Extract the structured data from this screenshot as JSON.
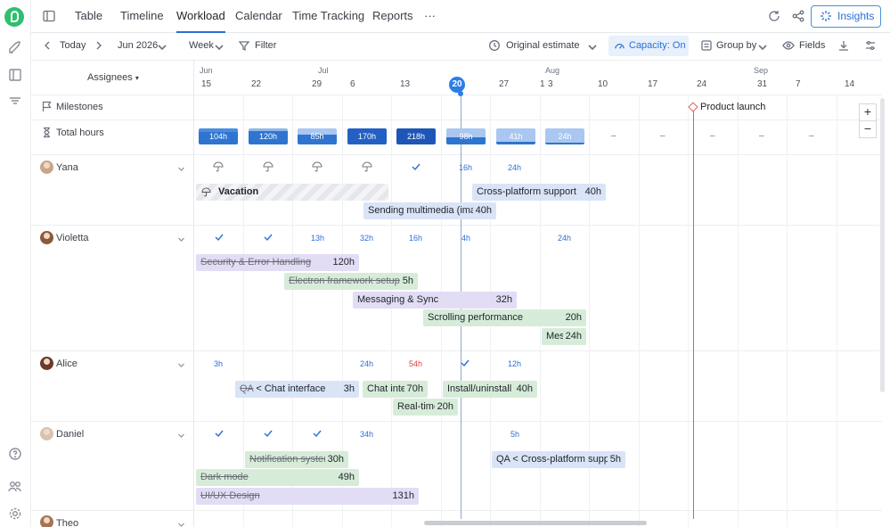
{
  "tabs": [
    "Table",
    "Timeline",
    "Workload",
    "Calendar",
    "Time Tracking",
    "Reports",
    "···"
  ],
  "insights_label": "Insights",
  "toolbar": {
    "today": "Today",
    "date": "Jun 2026",
    "view": "Week",
    "filter": "Filter",
    "estimate": "Original estimate",
    "capacity": "Capacity: On",
    "group_by": "Group by",
    "fields": "Fields"
  },
  "assignees_label": "Assignees",
  "months": [
    "Jun",
    "Jul",
    "Aug",
    "Sep"
  ],
  "days": [
    "15",
    "22",
    "29",
    "6",
    "13",
    "20",
    "27",
    "1",
    "3",
    "10",
    "17",
    "24",
    "31",
    "7",
    "14"
  ],
  "today_day": "20",
  "rows": {
    "milestones": "Milestones",
    "total_hours": "Total hours",
    "people": [
      "Yana",
      "Violetta",
      "Alice",
      "Daniel",
      "Theo"
    ]
  },
  "milestone_label": "Product launch",
  "total_hours": [
    "104h",
    "120h",
    "85h",
    "170h",
    "218h",
    "98h",
    "41h",
    "24h",
    "–",
    "–",
    "–",
    "–",
    "–"
  ],
  "workload": {
    "yana": [
      "16h",
      "24h"
    ],
    "violetta": [
      "13h",
      "32h",
      "16h",
      "4h",
      "24h"
    ],
    "alice": [
      "3h",
      "24h",
      "54h",
      "12h"
    ],
    "daniel": [
      "34h",
      "5h"
    ]
  },
  "tasks": {
    "vacation": {
      "name": "Vacation"
    },
    "cross_platform": {
      "name": "Cross-platform support",
      "hours": "40h"
    },
    "multimedia": {
      "name": "Sending multimedia (imag",
      "hours": "40h"
    },
    "security": {
      "name": "Security & Error Handling",
      "hours": "120h"
    },
    "electron": {
      "name": "Electron framework setup",
      "hours": "5h"
    },
    "messaging": {
      "name": "Messaging & Sync",
      "hours": "32h"
    },
    "scrolling": {
      "name": "Scrolling performance",
      "hours": "20h"
    },
    "mes": {
      "name": "Mes",
      "hours": "24h"
    },
    "qa_chat": {
      "name_strike": "QA",
      "name": "< Chat interface",
      "hours": "3h"
    },
    "chat_inter": {
      "name": "Chat inte",
      "hours": "70h"
    },
    "install": {
      "name": "Install/uninstall p",
      "hours": "40h"
    },
    "realtime": {
      "name": "Real-time",
      "hours": "20h"
    },
    "notification": {
      "name": "Notification system",
      "hours": "30h"
    },
    "qa_cross": {
      "name": "QA < Cross-platform suppor",
      "hours": "5h"
    },
    "dark_mode": {
      "name": "Dark mode",
      "hours": "49h"
    },
    "uiux": {
      "name": "UI/UX Design",
      "hours": "131h"
    }
  },
  "colors": {
    "accent": "#2b6fd6",
    "today": "#2b7ee8",
    "deadline": "#e35d5d",
    "overload": "#e04040"
  }
}
